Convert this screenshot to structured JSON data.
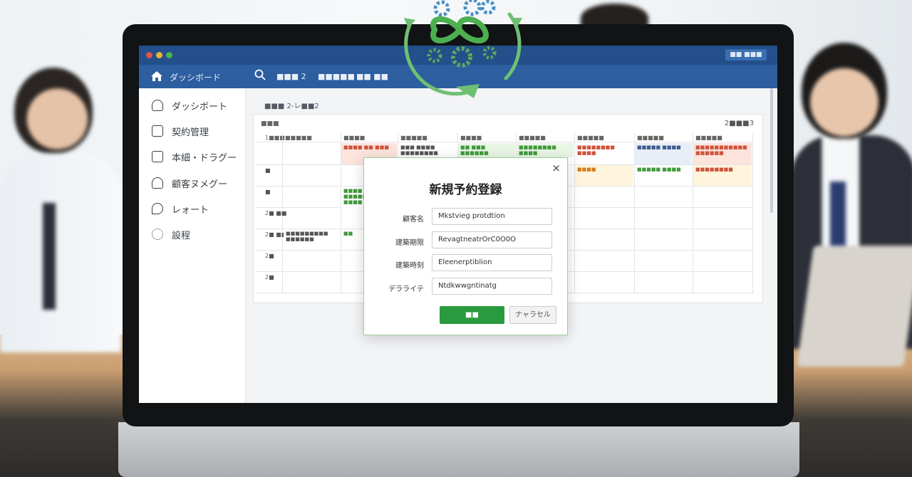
{
  "topbar": {
    "right_button": "■■ ■■■",
    "home_title": "ダッシボード",
    "links": [
      "■■■ 2",
      "■■■■■",
      "■■ ■■"
    ]
  },
  "sidebar": {
    "items": [
      {
        "label": "ダッシボート",
        "icon": "bell-icon"
      },
      {
        "label": "契約管理",
        "icon": "calendar-icon"
      },
      {
        "label": "本細・ドラグー",
        "icon": "document-icon"
      },
      {
        "label": "顧客ヌメグー",
        "icon": "users-icon"
      },
      {
        "label": "レォート",
        "icon": "location-icon"
      },
      {
        "label": "設程",
        "icon": "gear-icon"
      }
    ]
  },
  "breadcrumb": "■■■ 2-レ■■2",
  "calendar": {
    "label": "■■■",
    "right_text": "2■■■3",
    "headers": [
      "1■■■",
      "■■■■■",
      "■■■■",
      "■■■■■",
      "■■■■",
      "■■■■■",
      "■■■■■",
      "■■■■■",
      "■■■■■"
    ],
    "row_labels": [
      "",
      "■",
      "■",
      "2■ ■■",
      "2■ ■■■■■■■■■■",
      "2■",
      "2■"
    ],
    "events": [
      {
        "text": "■■■■ ■■ ■■■",
        "color": "red"
      },
      {
        "text": "■■■ ■■■■ ■■■■■■■■",
        "color": "plain"
      },
      {
        "text": "■■ ■■■ ■■■■■■",
        "color": "green"
      },
      {
        "text": "■■■■■■■■ ■■■■",
        "color": "green"
      },
      {
        "text": "■■■■■■■■ ■■■■",
        "color": "red"
      },
      {
        "text": "■■■■■ ■■■■",
        "color": "blue"
      },
      {
        "text": "■■■■■■■■■■■ ■■■■■■",
        "color": "red"
      },
      {
        "text": "■■■■",
        "color": "yellow"
      },
      {
        "text": "■■■■■ ■■■■",
        "color": "green"
      },
      {
        "text": "■■■■■■■■",
        "color": "yellow"
      },
      {
        "text": "■■■■ ■■■■■ ■■■■",
        "color": "green"
      },
      {
        "text": "■■■■■■■■■ ■■■■■■",
        "color": "plain"
      },
      {
        "text": "■■",
        "color": "green"
      }
    ]
  },
  "modal": {
    "title": "新規予約登録",
    "close": "×",
    "fields": [
      {
        "label": "顧客名",
        "value": "Mkstvieg protdtion"
      },
      {
        "label": "建築期限",
        "value": "RevagtneatrOrC0O0O"
      },
      {
        "label": "建築時刻",
        "value": "Eleenerptiblion"
      },
      {
        "label": "デラライテ",
        "value": "Ntdkwwgntinatg"
      }
    ],
    "save_label": "■■",
    "cancel_label": "ナャラセル"
  },
  "colors": {
    "topbar": "#2c5ea0",
    "accent_green": "#2a9a3e",
    "event_red": "#d0523a",
    "event_green": "#3f9a3a"
  }
}
